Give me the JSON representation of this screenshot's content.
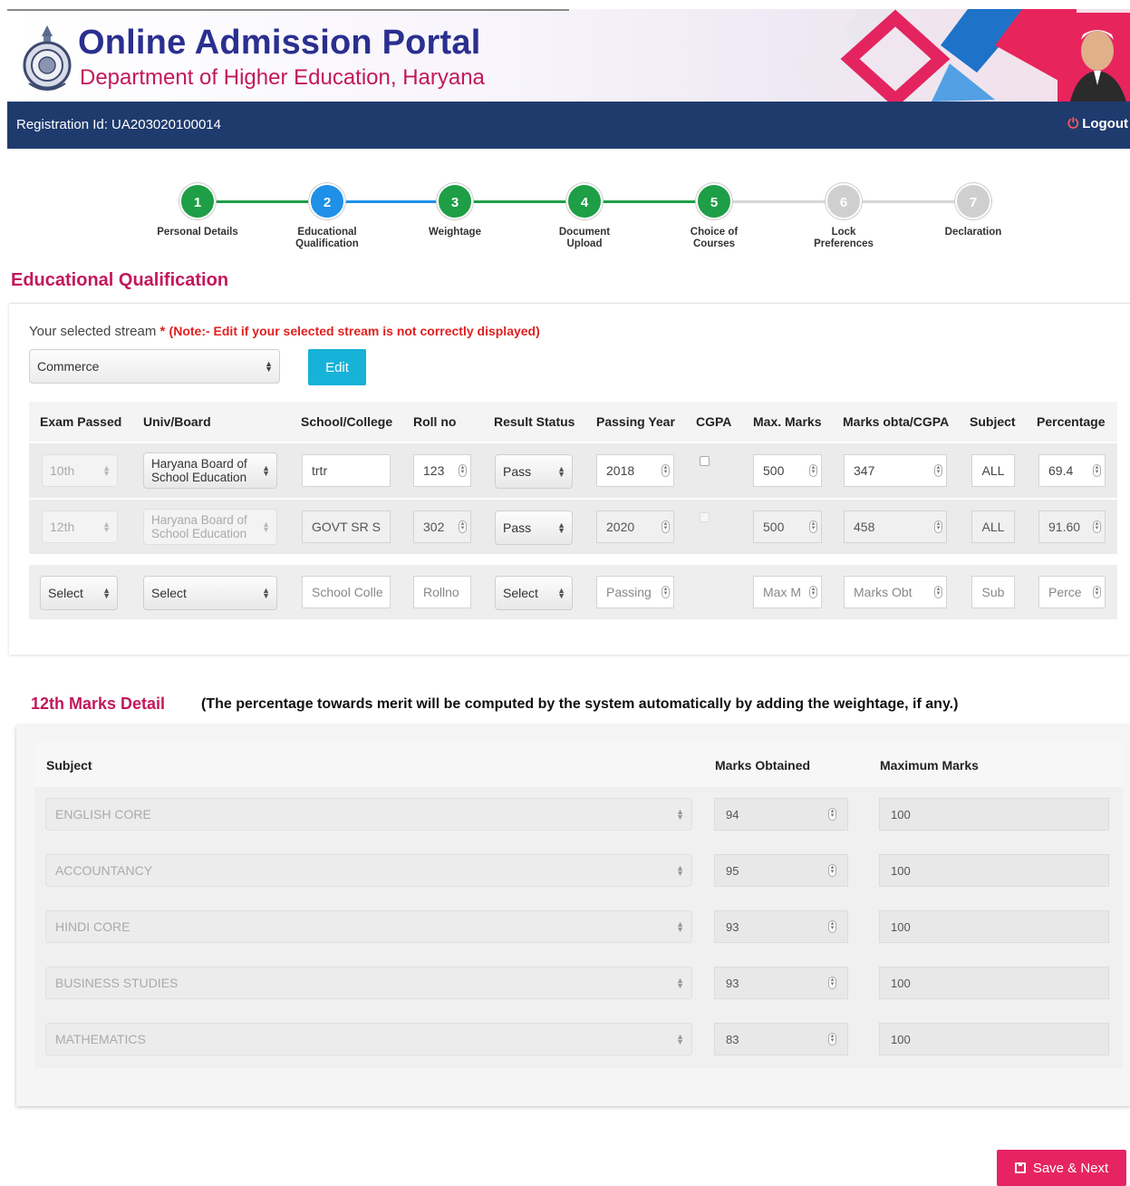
{
  "header": {
    "title": "Online Admission Portal",
    "subtitle": "Department of Higher Education, Haryana",
    "logo_icon": "state-emblem-icon",
    "portrait_icon": "official-portrait-icon"
  },
  "navbar": {
    "registration_label": "Registration Id: UA203020100014",
    "logout_label": "Logout",
    "logout_icon": "power-icon",
    "background": "#1f3b6e"
  },
  "stepper": {
    "steps": [
      {
        "number": "1",
        "label": "Personal Details",
        "state": "done",
        "color": "#1e9e46"
      },
      {
        "number": "2",
        "label": "Educational Qualification",
        "state": "current",
        "color": "#1e90e8"
      },
      {
        "number": "3",
        "label": "Weightage",
        "state": "done",
        "color": "#1e9e46"
      },
      {
        "number": "4",
        "label": "Document Upload",
        "state": "done",
        "color": "#1e9e46"
      },
      {
        "number": "5",
        "label": "Choice of Courses",
        "state": "done",
        "color": "#1e9e46"
      },
      {
        "number": "6",
        "label": "Lock Preferences",
        "state": "pending",
        "color": "#cfcfcf"
      },
      {
        "number": "7",
        "label": "Declaration",
        "state": "pending",
        "color": "#cfcfcf"
      }
    ]
  },
  "edu": {
    "section_title": "Educational Qualification",
    "stream_label": "Your selected stream",
    "required_mark": "*",
    "stream_note": "(Note:- Edit if your selected stream is not correctly displayed)",
    "stream_value": "Commerce",
    "edit_label": "Edit",
    "columns": [
      "Exam Passed",
      "Univ/Board",
      "School/College",
      "Roll no",
      "Result Status",
      "Passing Year",
      "CGPA",
      "Max. Marks",
      "Marks obta/CGPA",
      "Subject",
      "Percentage"
    ],
    "rows": [
      {
        "exam": "10th",
        "board": "Haryana Board of School Education",
        "school": "trtr",
        "roll": "123",
        "result": "Pass",
        "year": "2018",
        "max": "500",
        "marks": "347",
        "subject": "ALL",
        "percentage": "69.4"
      },
      {
        "exam": "12th",
        "board": "Haryana Board of School Education",
        "school": "GOVT SR S",
        "roll": "302",
        "result": "Pass",
        "year": "2020",
        "max": "500",
        "marks": "458",
        "subject": "ALL",
        "percentage": "91.60"
      }
    ],
    "new_row": {
      "exam": "Select",
      "board": "Select",
      "school_ph": "School Colle",
      "roll_ph": "Rollno",
      "result": "Select",
      "year_ph": "Passing",
      "max_ph": "Max M",
      "marks_ph": "Marks Obt",
      "subject_ph": "Sub",
      "percentage_ph": "Perce"
    }
  },
  "marks12": {
    "title": "12th Marks Detail",
    "note": "(The percentage towards merit will be computed by the system automatically by adding the weightage, if any.)",
    "columns": [
      "Subject",
      "Marks Obtained",
      "Maximum Marks"
    ],
    "rows": [
      {
        "subject": "ENGLISH CORE",
        "obtained": "94",
        "max": "100"
      },
      {
        "subject": "ACCOUNTANCY",
        "obtained": "95",
        "max": "100"
      },
      {
        "subject": "HINDI CORE",
        "obtained": "93",
        "max": "100"
      },
      {
        "subject": "BUSINESS STUDIES",
        "obtained": "93",
        "max": "100"
      },
      {
        "subject": "MATHEMATICS",
        "obtained": "83",
        "max": "100"
      }
    ]
  },
  "footer": {
    "save_label": "Save & Next",
    "save_icon": "floppy-disk-icon",
    "save_color": "#e62463"
  }
}
